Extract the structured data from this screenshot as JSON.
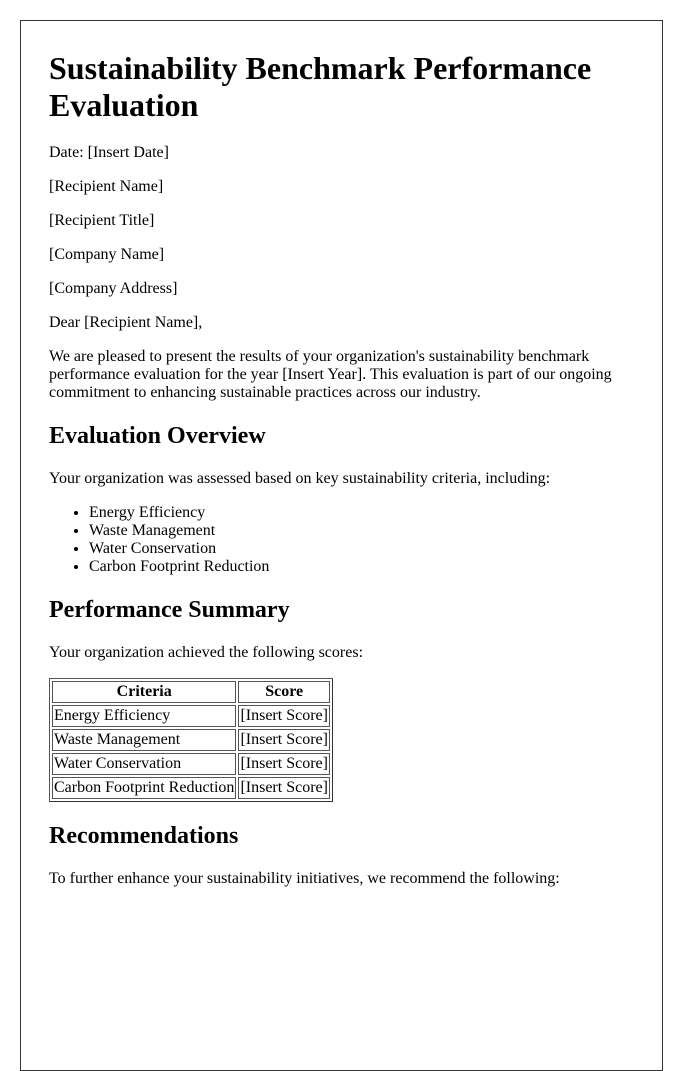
{
  "document": {
    "title": "Sustainability Benchmark Performance Evaluation",
    "date_line": "Date: [Insert Date]",
    "recipient_name": "[Recipient Name]",
    "recipient_title": "[Recipient Title]",
    "company_name": "[Company Name]",
    "company_address": "[Company Address]",
    "salutation": "Dear [Recipient Name],",
    "intro": "We are pleased to present the results of your organization's sustainability benchmark performance evaluation for the year [Insert Year]. This evaluation is part of our ongoing commitment to enhancing sustainable practices across our industry."
  },
  "overview": {
    "heading": "Evaluation Overview",
    "text": "Your organization was assessed based on key sustainability criteria, including:",
    "criteria": [
      "Energy Efficiency",
      "Waste Management",
      "Water Conservation",
      "Carbon Footprint Reduction"
    ]
  },
  "summary": {
    "heading": "Performance Summary",
    "text": "Your organization achieved the following scores:",
    "table": {
      "headers": [
        "Criteria",
        "Score"
      ],
      "rows": [
        [
          "Energy Efficiency",
          "[Insert Score]"
        ],
        [
          "Waste Management",
          "[Insert Score]"
        ],
        [
          "Water Conservation",
          "[Insert Score]"
        ],
        [
          "Carbon Footprint Reduction",
          "[Insert Score]"
        ]
      ]
    }
  },
  "recommendations": {
    "heading": "Recommendations",
    "text": "To further enhance your sustainability initiatives, we recommend the following:"
  }
}
